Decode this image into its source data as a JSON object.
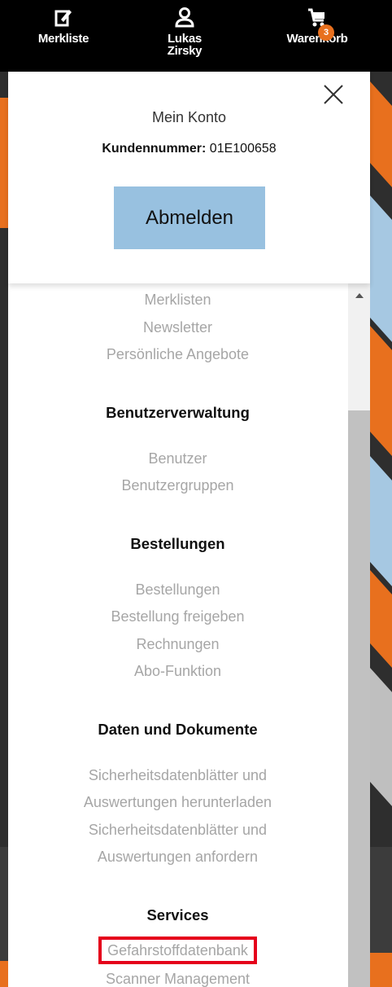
{
  "header": {
    "merkliste": {
      "label": "Merkliste",
      "icon": "note-edit-icon"
    },
    "user": {
      "label": "Lukas Zirsky",
      "icon": "user-icon"
    },
    "cart": {
      "label": "Warenkorb",
      "icon": "cart-icon",
      "badge": "3"
    }
  },
  "account": {
    "title": "Mein Konto",
    "customer_label": "Kundennummer:",
    "customer_number": "01E100658",
    "logout_label": "Abmelden",
    "close_icon": "close-icon"
  },
  "menu": {
    "top_items": [
      "Merklisten",
      "Newsletter",
      "Persönliche Angebote"
    ],
    "sections": [
      {
        "heading": "Benutzerverwaltung",
        "items": [
          "Benutzer",
          "Benutzergruppen"
        ]
      },
      {
        "heading": "Bestellungen",
        "items": [
          "Bestellungen",
          "Bestellung freigeben",
          "Rechnungen",
          "Abo-Funktion"
        ]
      },
      {
        "heading": "Daten und Dokumente",
        "items": [
          "Sicherheitsdatenblätter und",
          "Auswertungen herunterladen",
          "Sicherheitsdatenblätter und",
          "Auswertungen anfordern"
        ]
      },
      {
        "heading": "Services",
        "items": [
          "Gefahrstoffdatenbank",
          "Scanner Management"
        ]
      }
    ]
  },
  "colors": {
    "accent_orange": "#e8701e",
    "logout_blue": "#98c1e0",
    "highlight_red": "#e5001b",
    "stripe_blue": "#a6c8e2"
  }
}
